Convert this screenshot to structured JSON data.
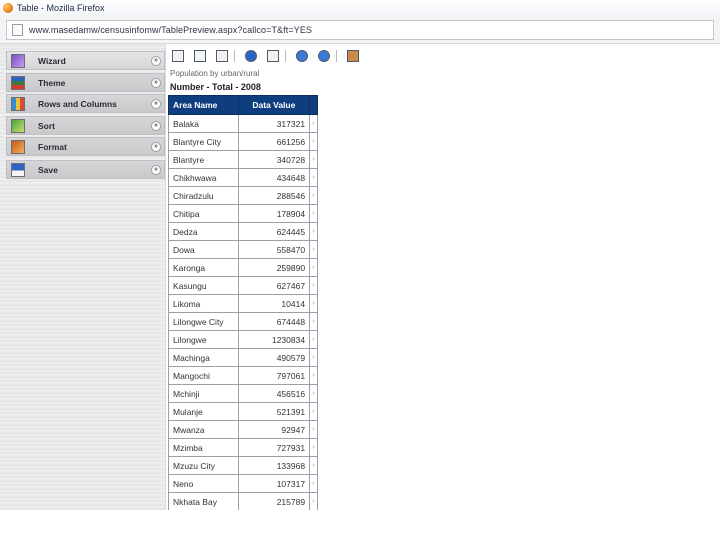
{
  "window": {
    "title": "Table - Mozilla Firefox"
  },
  "address_bar": {
    "url": "www.masedamw/censusinfomw/TablePreview.aspx?callco=T&ft=YES"
  },
  "sidebar": {
    "items": [
      {
        "label": "Wizard",
        "icon": "wizard-icon",
        "chevron": "»"
      },
      {
        "label": "Theme",
        "icon": "theme-icon",
        "chevron": "»"
      },
      {
        "label": "Rows and Columns",
        "icon": "rows-columns-icon",
        "chevron": "»"
      },
      {
        "label": "Sort",
        "icon": "sort-icon",
        "chevron": "»"
      },
      {
        "label": "Format",
        "icon": "format-icon",
        "chevron": "»"
      },
      {
        "label": "Save",
        "icon": "save-icon",
        "chevron": "»"
      }
    ]
  },
  "content": {
    "subtitle": "Population by urban/rural",
    "table_title": "Number - Total - 2008",
    "columns": [
      "Area Name",
      "Data Value"
    ],
    "rows": [
      {
        "name": "Balaka",
        "value": "317321"
      },
      {
        "name": "Blantyre City",
        "value": "661256"
      },
      {
        "name": "Blantyre",
        "value": "340728"
      },
      {
        "name": "Chikhwawa",
        "value": "434648"
      },
      {
        "name": "Chiradzulu",
        "value": "288546"
      },
      {
        "name": "Chitipa",
        "value": "178904"
      },
      {
        "name": "Dedza",
        "value": "624445"
      },
      {
        "name": "Dowa",
        "value": "558470"
      },
      {
        "name": "Karonga",
        "value": "259890"
      },
      {
        "name": "Kasungu",
        "value": "627467"
      },
      {
        "name": "Likoma",
        "value": "10414"
      },
      {
        "name": "Lilongwe City",
        "value": "674448"
      },
      {
        "name": "Lilongwe",
        "value": "1230834"
      },
      {
        "name": "Machinga",
        "value": "490579"
      },
      {
        "name": "Mangochi",
        "value": "797061"
      },
      {
        "name": "Mchinji",
        "value": "456516"
      },
      {
        "name": "Mulanje",
        "value": "521391"
      },
      {
        "name": "Mwanza",
        "value": "92947"
      },
      {
        "name": "Mzimba",
        "value": "727931"
      },
      {
        "name": "Mzuzu City",
        "value": "133968"
      },
      {
        "name": "Neno",
        "value": "107317"
      },
      {
        "name": "Nkhata Bay",
        "value": "215789"
      }
    ]
  },
  "toolbar": {
    "icons": [
      "grid-icon",
      "columns-icon",
      "chart-icon",
      "search-icon",
      "tools-icon",
      "refresh-icon",
      "help-icon",
      "export-icon"
    ]
  },
  "colors": {
    "table_header": "#0e3e7e",
    "sidebar_bg": "#e7e7e9"
  }
}
